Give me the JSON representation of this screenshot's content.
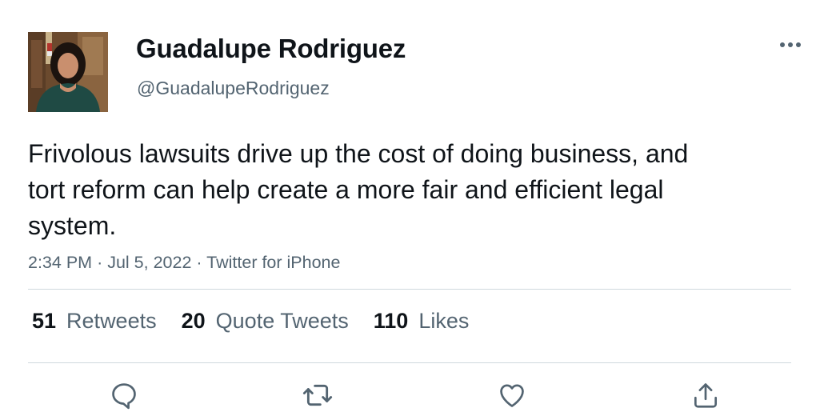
{
  "tweet": {
    "author": {
      "display_name": "Guadalupe Rodriguez",
      "handle": "@GuadalupeRodriguez"
    },
    "text": "Frivolous lawsuits drive up the cost of doing business, and tort reform can help create a more fair and efficient legal system.",
    "meta": {
      "time": "2:34 PM",
      "date": "Jul 5, 2022",
      "source": "Twitter for iPhone",
      "separator": "·"
    },
    "stats": {
      "retweets": {
        "count": "51",
        "label": "Retweets"
      },
      "quote_tweets": {
        "count": "20",
        "label": "Quote Tweets"
      },
      "likes": {
        "count": "110",
        "label": "Likes"
      }
    }
  },
  "actions": {
    "reply": "reply-icon",
    "retweet": "retweet-icon",
    "like": "heart-icon",
    "share": "share-icon"
  },
  "colors": {
    "text": "#0f1419",
    "secondary": "#536471",
    "divider": "#cfd9de"
  }
}
